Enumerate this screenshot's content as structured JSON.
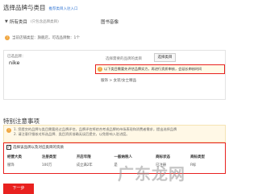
{
  "header": {
    "title": "选择品牌与类目",
    "link": "推荐类目入驻入口"
  },
  "brand_select": {
    "caret": "▼",
    "label": "所有类目",
    "hint": "(只包含品牌类目)",
    "right_name": "图书音像"
  },
  "current_categories": {
    "text": "当前店铺类型：旗舰店，可选品牌数：1个"
  },
  "selection": {
    "left_label": "已选品牌：",
    "left_value": "nike",
    "right_label": "选择需要的品牌的类目",
    "select_button": "选择类目",
    "warning": "以下类目需要先评估品牌实力，再进行资质审核，会延长审核时间",
    "breadcrumb": "服饰 > 女装/女士精品"
  },
  "special": {
    "title": "特别注意事项",
    "notice_line1": "1. 您提交的品牌与类目需要经过品牌评估，品牌评估将综合考虑品牌的市场表现和消费者需求，提出选择品牌",
    "notice_line2": "2. 请注意仔细核对所选品牌、类目资质准确无误后提交，以免影响入驻进度。"
  },
  "table": {
    "checkbox_label": "选择该品牌以及对应类目的资质",
    "headers": [
      "经营大类",
      "注册类型",
      "开店年限",
      "一般纳税人",
      "商标状态",
      "商标类型"
    ],
    "rows": [
      [
        "服饰",
        "100万",
        "成立满2年",
        "是",
        "已注册",
        "R标"
      ]
    ]
  },
  "footer": {
    "next_button": "下一步"
  },
  "watermark": "广东龙网"
}
